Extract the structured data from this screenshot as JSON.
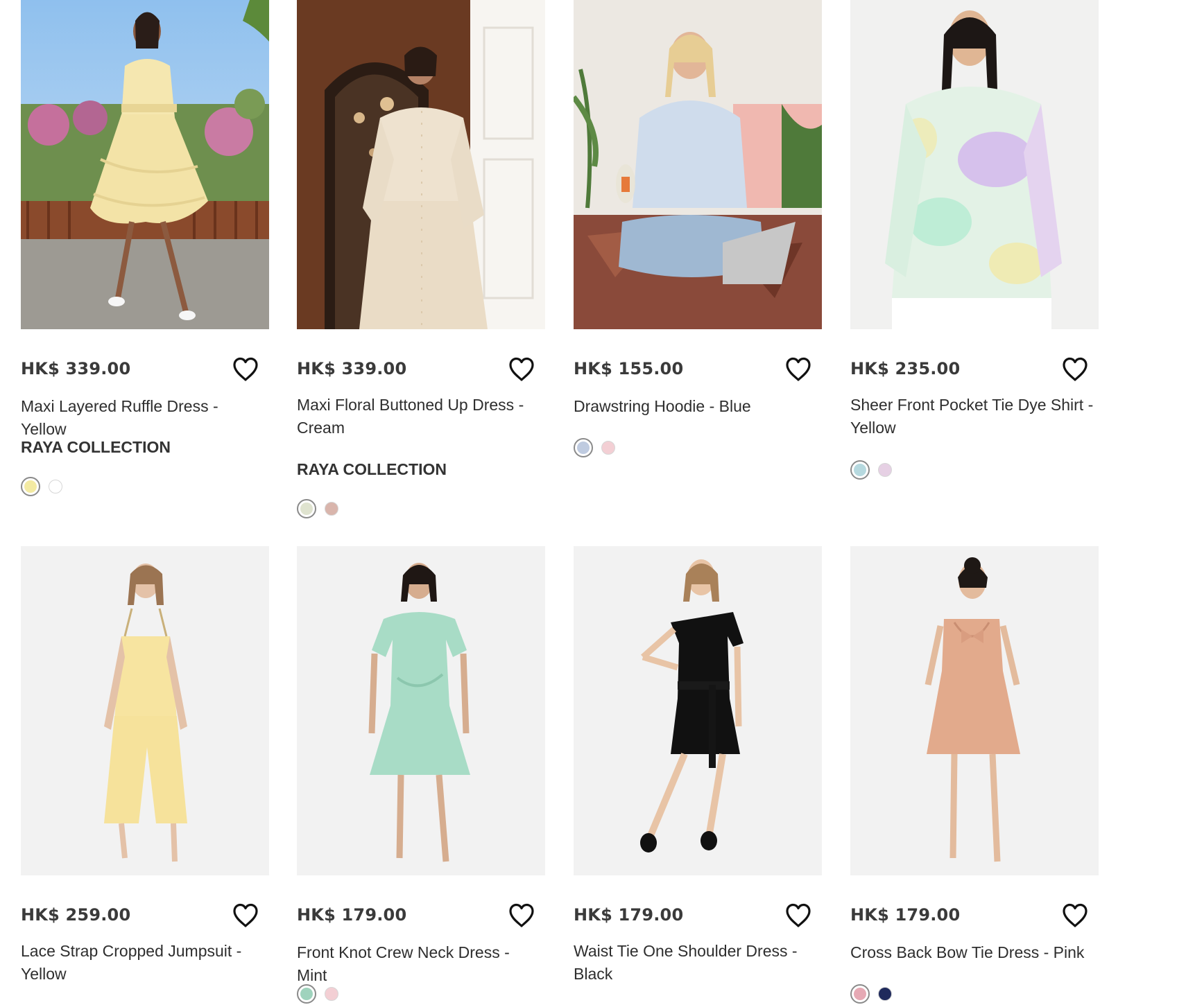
{
  "products": [
    {
      "price": "HK$ 339.00",
      "name": "Maxi Layered Ruffle Dress - Yellow",
      "tag": "RAYA COLLECTION",
      "swatches": [
        "#f3eaa2",
        "#ffffff"
      ]
    },
    {
      "price": "HK$ 339.00",
      "name": "Maxi Floral Buttoned Up Dress - Cream",
      "tag": "RAYA COLLECTION",
      "swatches": [
        "#dfe3cf",
        "#d9b5ac"
      ]
    },
    {
      "price": "HK$ 155.00",
      "name": "Drawstring Hoodie - Blue",
      "tag": "",
      "swatches": [
        "#bfcbe0",
        "#f3cfd4"
      ]
    },
    {
      "price": "HK$ 235.00",
      "name": "Sheer Front Pocket Tie Dye Shirt - Yellow",
      "tag": "",
      "swatches": [
        "#b6d9df",
        "#e6d0e4"
      ]
    },
    {
      "price": "HK$ 259.00",
      "name": "Lace Strap Cropped Jumpsuit - Yellow",
      "tag": "",
      "swatches": []
    },
    {
      "price": "HK$ 179.00",
      "name": "Front Knot Crew Neck Dress - Mint",
      "tag": "",
      "swatches": [
        "#9fd3bd",
        "#f3cfd4"
      ]
    },
    {
      "price": "HK$ 179.00",
      "name": "Waist Tie One Shoulder Dress - Black",
      "tag": "",
      "swatches": []
    },
    {
      "price": "HK$ 179.00",
      "name": "Cross Back Bow Tie Dress - Pink",
      "tag": "",
      "swatches": [
        "#e6a9b4",
        "#1f2a5c"
      ]
    }
  ],
  "icons": {
    "wishlist": "heart-outline-icon"
  }
}
